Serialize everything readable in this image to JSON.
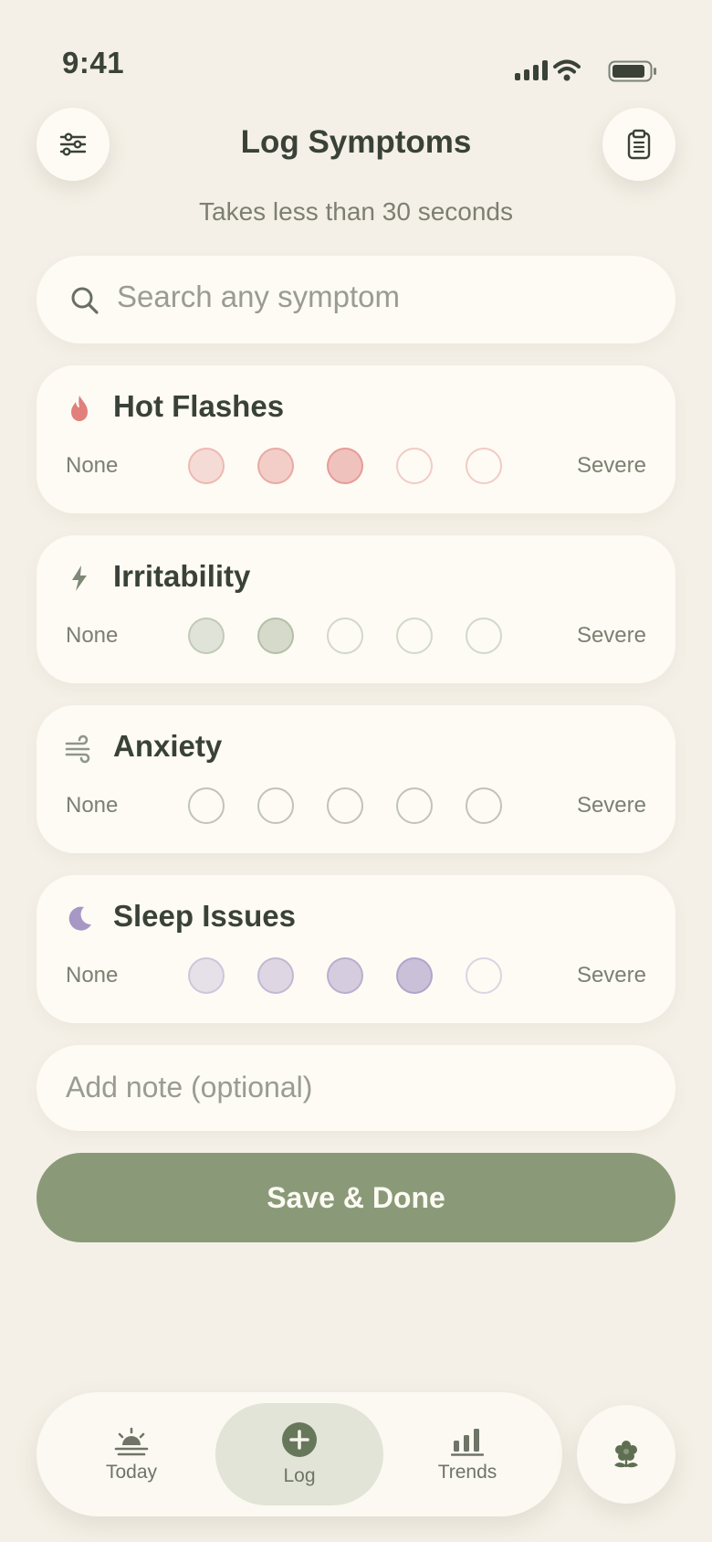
{
  "status_bar": {
    "time": "9:41"
  },
  "header": {
    "title": "Log Symptoms",
    "subtitle": "Takes less than 30 seconds",
    "left_icon": "sliders-icon",
    "right_icon": "clipboard-icon"
  },
  "search": {
    "placeholder": "Search any symptom",
    "value": ""
  },
  "symptoms": [
    {
      "name": "Hot Flashes",
      "icon": "flame-icon",
      "level": 3,
      "scale_min_label": "None",
      "scale_max_label": "Severe",
      "color": "#e07f7c"
    },
    {
      "name": "Irritability",
      "icon": "lightning-icon",
      "level": 2,
      "scale_min_label": "None",
      "scale_max_label": "Severe",
      "color": "#8fa082"
    },
    {
      "name": "Anxiety",
      "icon": "wind-icon",
      "level": 0,
      "scale_min_label": "None",
      "scale_max_label": "Severe",
      "color": "#8f968a"
    },
    {
      "name": "Sleep Issues",
      "icon": "moon-icon",
      "level": 4,
      "scale_min_label": "None",
      "scale_max_label": "Severe",
      "color": "#a697c4"
    }
  ],
  "note": {
    "placeholder": "Add note (optional)",
    "value": ""
  },
  "save_button": {
    "label": "Save & Done",
    "color": "#8a9a78"
  },
  "nav": {
    "items": [
      {
        "label": "Today",
        "icon": "sunrise-icon"
      },
      {
        "label": "Log",
        "icon": "plus-circle-icon",
        "active": true
      },
      {
        "label": "Trends",
        "icon": "bar-chart-icon"
      }
    ],
    "extra_icon": "flower-icon"
  },
  "colors": {
    "background": "#f4f0e7",
    "surface": "#fdfbf4",
    "text": "#3a4237",
    "muted_text": "#7c7f72",
    "accent": "#8a9a78"
  }
}
